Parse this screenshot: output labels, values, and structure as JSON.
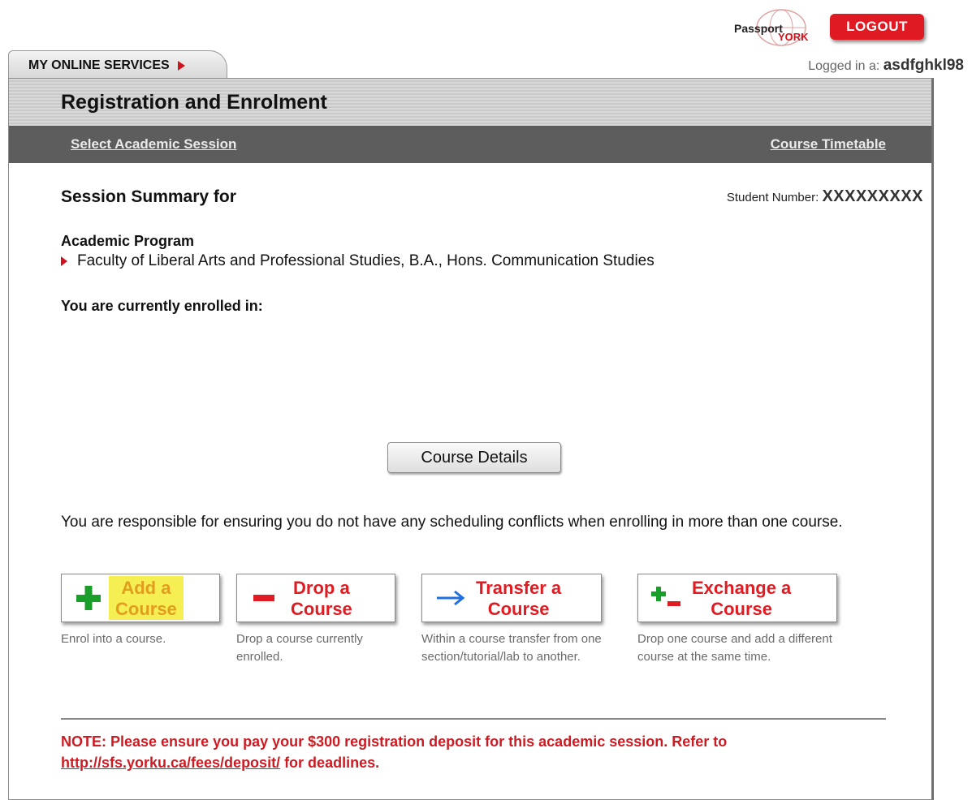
{
  "header": {
    "tab_label": "MY ONLINE SERVICES",
    "logo_text_1": "Passport",
    "logo_text_2": "YORK",
    "logout_label": "LOGOUT",
    "logged_in_prefix": "Logged in a:",
    "username": "asdfghkl98"
  },
  "panel": {
    "title": "Registration and Enrolment",
    "nav": {
      "left_link": "Select Academic Session",
      "right_link": "Course Timetable"
    }
  },
  "session": {
    "title": "Session Summary for",
    "student_number_label": "Student Number:",
    "student_number_value": "XXXXXXXXX",
    "program_label": "Academic Program",
    "program_item": "Faculty of Liberal Arts and Professional Studies, B.A., Hons. Communication Studies",
    "enrolled_label": "You are currently enrolled in:",
    "details_button": "Course Details",
    "warning": "You are responsible for ensuring you do not have any scheduling conflicts when enrolling in more than one course."
  },
  "actions": [
    {
      "line1": "Add a",
      "line2": "Course",
      "desc": "Enrol into a course."
    },
    {
      "line1": "Drop a",
      "line2": "Course",
      "desc": "Drop a course currently enrolled."
    },
    {
      "line1": "Transfer a",
      "line2": "Course",
      "desc": "Within a course transfer from one section/tutorial/lab to another."
    },
    {
      "line1": "Exchange a",
      "line2": "Course",
      "desc": "Drop one course and add a different course at the same time."
    }
  ],
  "note": {
    "text_before": "NOTE: Please ensure you pay your $300 registration deposit for this academic session. Refer to ",
    "link": "http://sfs.yorku.ca/fees/deposit/",
    "text_after": " for deadlines."
  },
  "colors": {
    "brand_red": "#e01a22",
    "nav_gray": "#5d5d5d",
    "highlight_yellow": "#f6ef54",
    "plus_green": "#1a9e2a",
    "arrow_blue": "#1f6fe0"
  }
}
